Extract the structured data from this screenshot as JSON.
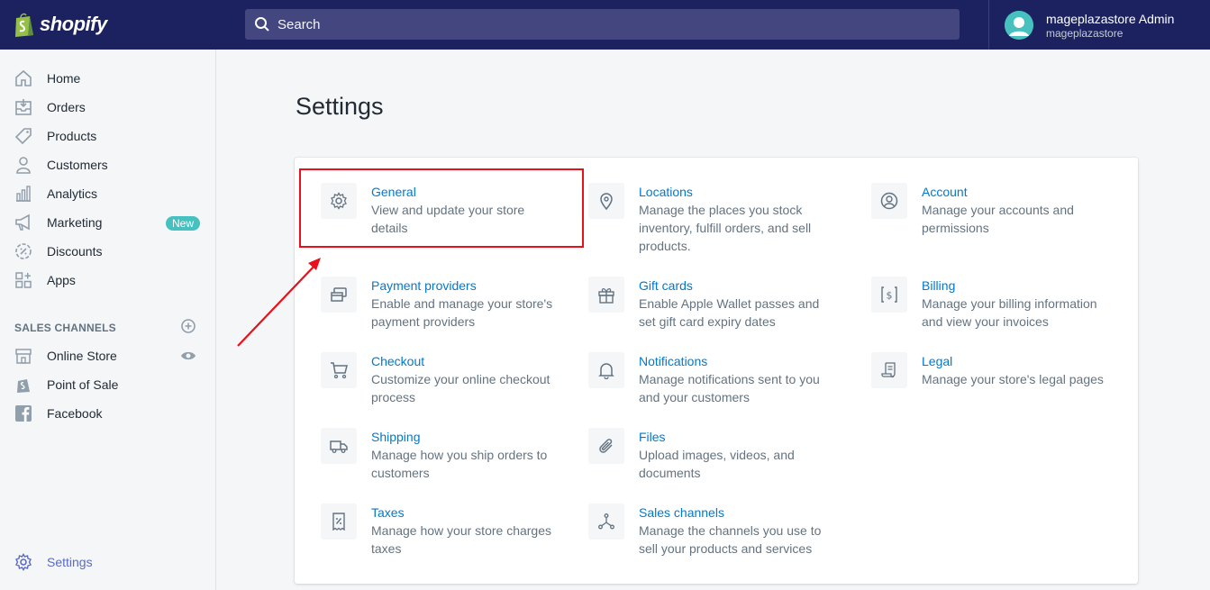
{
  "brand": {
    "logo_text": "shopify"
  },
  "search": {
    "placeholder": "Search"
  },
  "user": {
    "name": "mageplazastore Admin",
    "store": "mageplazastore"
  },
  "sidebar": {
    "items": [
      {
        "label": "Home",
        "icon": "home-icon"
      },
      {
        "label": "Orders",
        "icon": "orders-icon"
      },
      {
        "label": "Products",
        "icon": "tag-icon"
      },
      {
        "label": "Customers",
        "icon": "person-icon"
      },
      {
        "label": "Analytics",
        "icon": "bar-chart-icon"
      },
      {
        "label": "Marketing",
        "icon": "megaphone-icon",
        "badge": "New"
      },
      {
        "label": "Discounts",
        "icon": "discount-icon"
      },
      {
        "label": "Apps",
        "icon": "apps-icon"
      }
    ],
    "section_title": "SALES CHANNELS",
    "channels": [
      {
        "label": "Online Store",
        "icon": "store-icon"
      },
      {
        "label": "Point of Sale",
        "icon": "shopify-bag-icon"
      },
      {
        "label": "Facebook",
        "icon": "facebook-icon"
      }
    ],
    "settings_label": "Settings"
  },
  "page": {
    "title": "Settings"
  },
  "settings_items": [
    {
      "title": "General",
      "desc": "View and update your store details",
      "icon": "gear-icon"
    },
    {
      "title": "Locations",
      "desc": "Manage the places you stock inventory, fulfill orders, and sell products.",
      "icon": "location-pin-icon"
    },
    {
      "title": "Account",
      "desc": "Manage your accounts and permissions",
      "icon": "account-icon"
    },
    {
      "title": "Payment providers",
      "desc": "Enable and manage your store's payment providers",
      "icon": "payment-icon"
    },
    {
      "title": "Gift cards",
      "desc": "Enable Apple Wallet passes and set gift card expiry dates",
      "icon": "gift-icon"
    },
    {
      "title": "Billing",
      "desc": "Manage your billing information and view your invoices",
      "icon": "billing-icon"
    },
    {
      "title": "Checkout",
      "desc": "Customize your online checkout process",
      "icon": "cart-icon"
    },
    {
      "title": "Notifications",
      "desc": "Manage notifications sent to you and your customers",
      "icon": "bell-icon"
    },
    {
      "title": "Legal",
      "desc": "Manage your store's legal pages",
      "icon": "legal-icon"
    },
    {
      "title": "Shipping",
      "desc": "Manage how you ship orders to customers",
      "icon": "truck-icon"
    },
    {
      "title": "Files",
      "desc": "Upload images, videos, and documents",
      "icon": "paperclip-icon"
    },
    {
      "title": "Taxes",
      "desc": "Manage how your store charges taxes",
      "icon": "tax-icon"
    },
    {
      "title": "Sales channels",
      "desc": "Manage the channels you use to sell your products and services",
      "icon": "sales-channels-icon"
    }
  ],
  "colors": {
    "topbar": "#1c2260",
    "link": "#007ace",
    "highlight": "#e8101a",
    "badge": "#47c1bf",
    "settings_active": "#5c6ac4"
  }
}
